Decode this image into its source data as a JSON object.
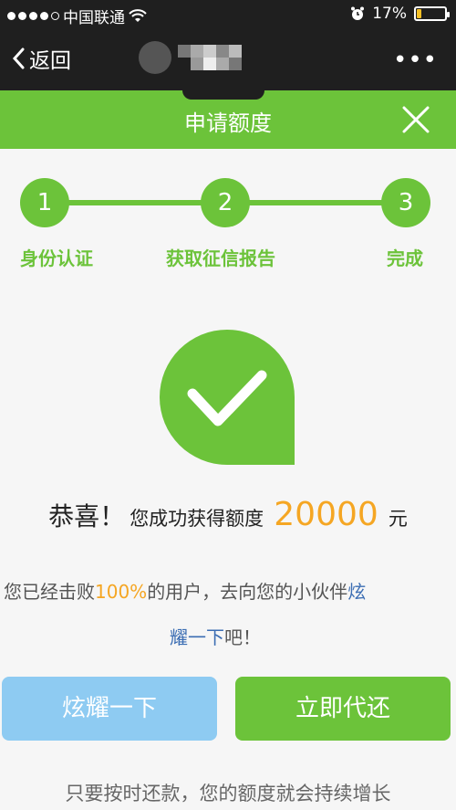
{
  "status_bar": {
    "carrier": "中国联通",
    "battery": "17%",
    "battery_level": 0.17
  },
  "nav": {
    "back_label": "返回",
    "more_label": "•••"
  },
  "header": {
    "title": "申请额度"
  },
  "steps": [
    {
      "number": "1",
      "label": "身份认证"
    },
    {
      "number": "2",
      "label": "获取征信报告"
    },
    {
      "number": "3",
      "label": "完成"
    }
  ],
  "result": {
    "congrats": "恭喜！",
    "message": "您成功获得额度",
    "amount": "20000",
    "unit": "元"
  },
  "brag": {
    "prefix": "您已经击败",
    "percent": "100%",
    "middle": "的用户，去向您的小伙伴",
    "link_part1": "炫",
    "link_part2": "耀一下",
    "suffix": "吧！"
  },
  "buttons": {
    "brag": "炫耀一下",
    "repay": "立即代还"
  },
  "footer": {
    "text": "只要按时还款，您的额度就会持续增长"
  },
  "colors": {
    "accent": "#6cc33a",
    "amount": "#f5a623",
    "brag_button": "#8ecbf2",
    "link": "#3b6db3"
  }
}
